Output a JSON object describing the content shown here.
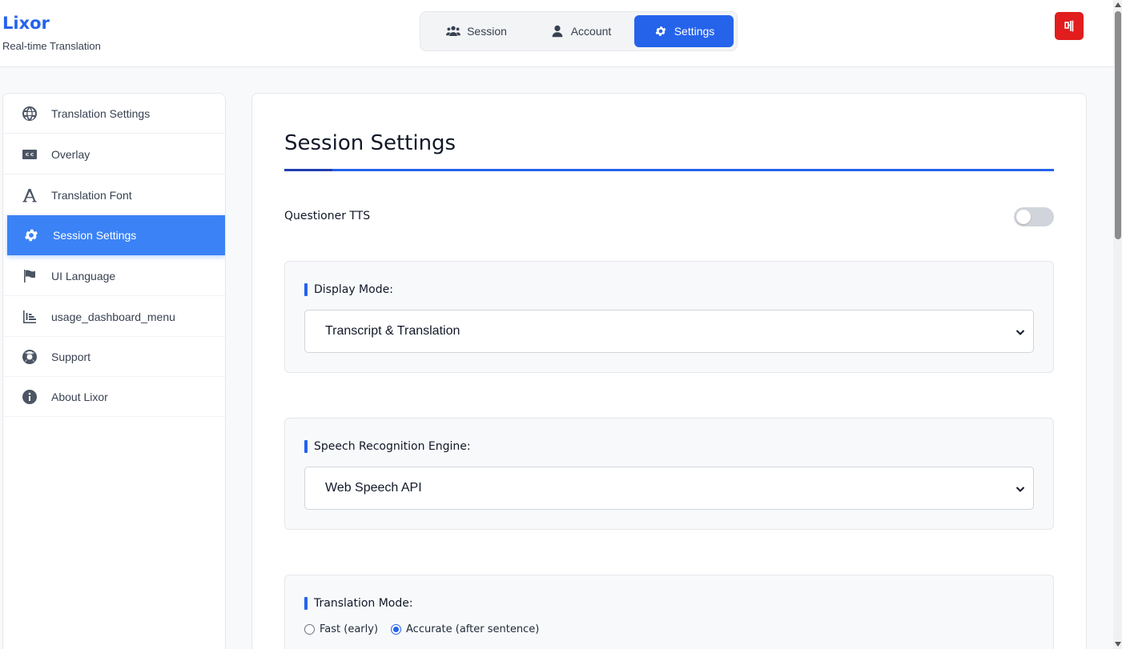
{
  "brand": {
    "name": "Lixor",
    "subtitle": "Real-time Translation"
  },
  "tabs": [
    {
      "label": "Session",
      "icon": "users-icon"
    },
    {
      "label": "Account",
      "icon": "user-icon"
    },
    {
      "label": "Settings",
      "icon": "gear-icon",
      "active": true
    }
  ],
  "avatar": {
    "text": "메",
    "color": "#e11d1d"
  },
  "sidebar": {
    "items": [
      {
        "label": "Translation Settings",
        "icon": "globe-icon"
      },
      {
        "label": "Overlay",
        "icon": "closed-caption-icon"
      },
      {
        "label": "Translation Font",
        "icon": "font-icon"
      },
      {
        "label": "Session Settings",
        "icon": "gear-icon",
        "active": true
      },
      {
        "label": "UI Language",
        "icon": "flag-icon"
      },
      {
        "label": "usage_dashboard_menu",
        "icon": "bar-chart-icon"
      },
      {
        "label": "Support",
        "icon": "life-ring-icon"
      },
      {
        "label": "About Lixor",
        "icon": "info-icon"
      }
    ]
  },
  "main": {
    "title": "Session Settings",
    "questioner_tts": {
      "label": "Questioner TTS",
      "enabled": false
    },
    "display_mode": {
      "label": "Display Mode:",
      "value": "Transcript & Translation"
    },
    "speech_engine": {
      "label": "Speech Recognition Engine:",
      "value": "Web Speech API"
    },
    "translation_mode": {
      "label": "Translation Mode:",
      "options": [
        {
          "label": "Fast (early)",
          "checked": false
        },
        {
          "label": "Accurate (after sentence)",
          "checked": true
        }
      ]
    }
  },
  "colors": {
    "accent": "#2563eb",
    "sidebar_active": "#3b82f6",
    "avatar": "#e11d1d"
  }
}
